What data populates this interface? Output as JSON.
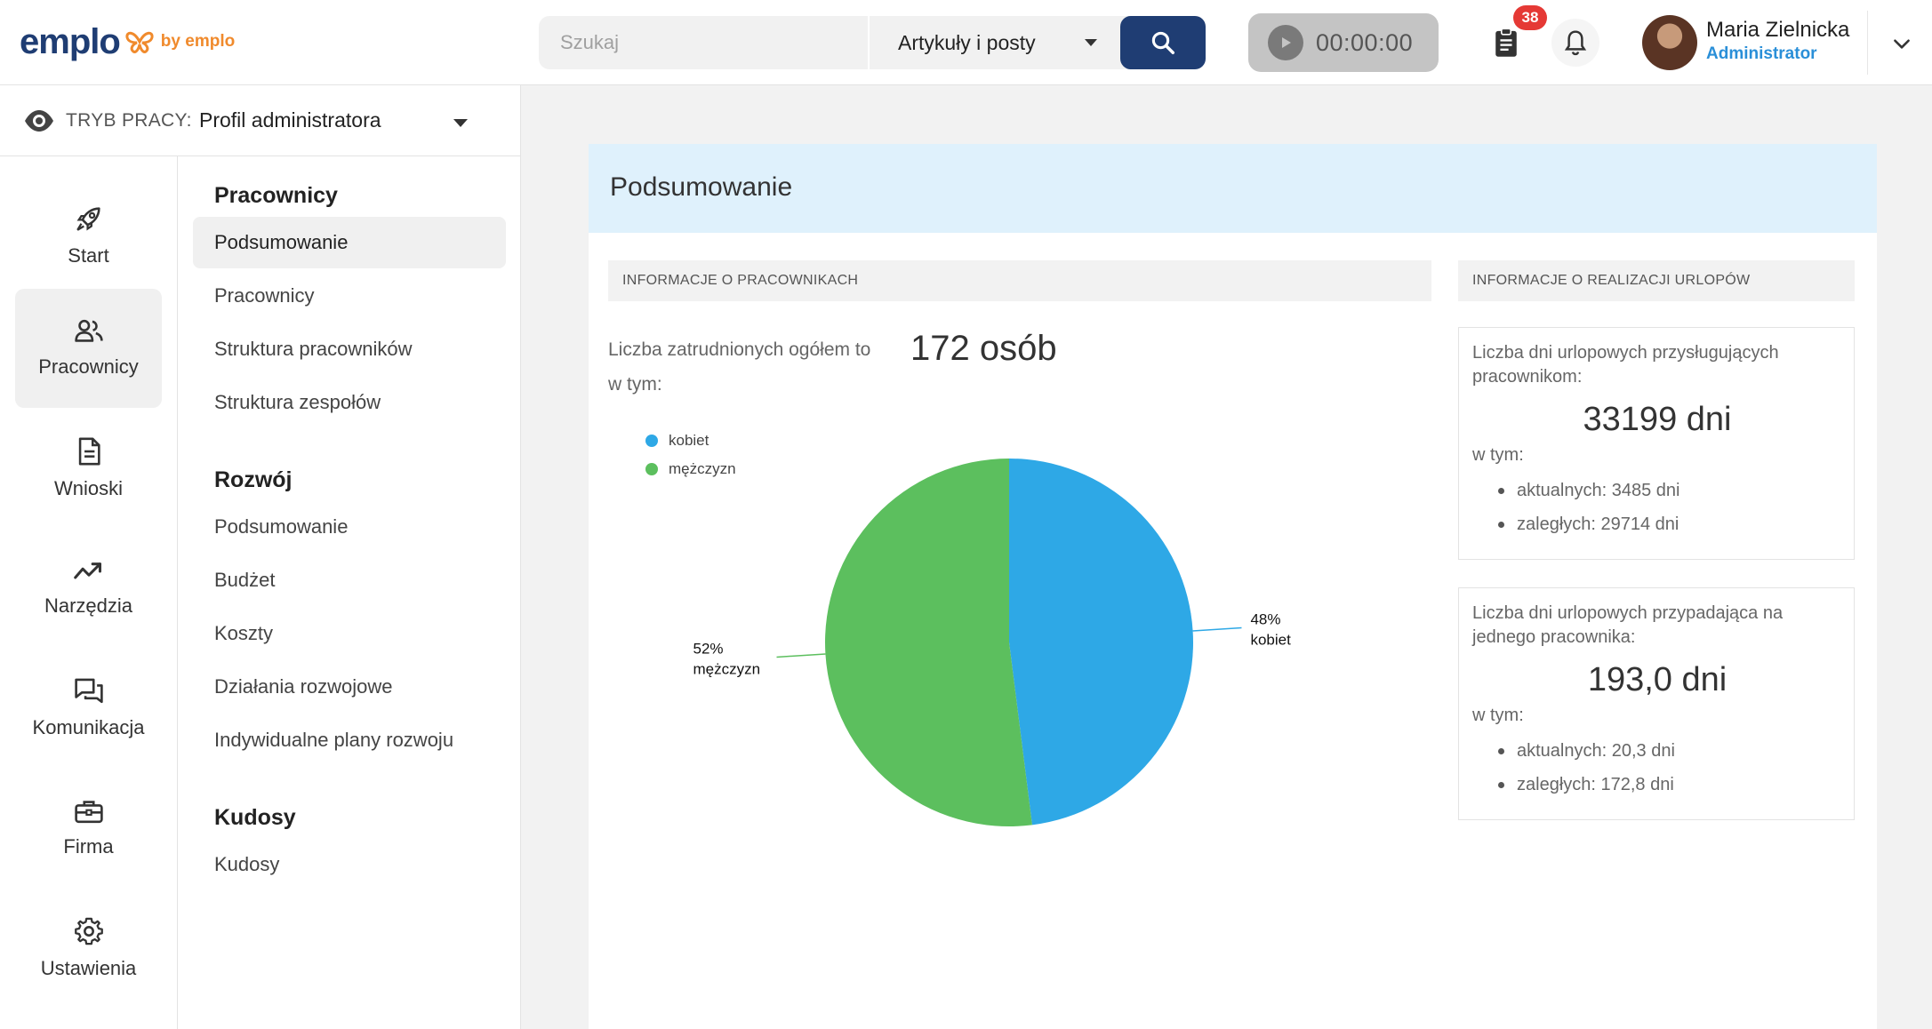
{
  "header": {
    "logo_text": "emplo",
    "logo_by": "by emplo",
    "search_placeholder": "Szukaj",
    "search_scope": "Artykuły i posty",
    "timer": "00:00:00",
    "tasks_badge": "38",
    "user_name": "Maria Zielnicka",
    "user_role": "Administrator"
  },
  "mode": {
    "label": "TRYB PRACY:",
    "value": "Profil administratora"
  },
  "nav": [
    {
      "label": "Start",
      "icon": "rocket-icon"
    },
    {
      "label": "Pracownicy",
      "icon": "people-icon"
    },
    {
      "label": "Wnioski",
      "icon": "document-icon"
    },
    {
      "label": "Narzędzia",
      "icon": "trend-icon"
    },
    {
      "label": "Komunikacja",
      "icon": "chat-icon"
    },
    {
      "label": "Firma",
      "icon": "briefcase-icon"
    },
    {
      "label": "Ustawienia",
      "icon": "gear-icon"
    }
  ],
  "submenu": {
    "sections": [
      {
        "title": "Pracownicy",
        "items": [
          "Podsumowanie",
          "Pracownicy",
          "Struktura pracowników",
          "Struktura zespołów"
        ]
      },
      {
        "title": "Rozwój",
        "items": [
          "Podsumowanie",
          "Budżet",
          "Koszty",
          "Działania rozwojowe",
          "Indywidualne plany rozwoju"
        ]
      },
      {
        "title": "Kudosy",
        "items": [
          "Kudosy"
        ]
      }
    ]
  },
  "main": {
    "title": "Podsumowanie",
    "employees": {
      "section_title": "INFORMACJE O PRACOWNIKACH",
      "total_text": "Liczba zatrudnionych ogółem to",
      "in_that": "w tym:",
      "total_value": "172 osób"
    },
    "leave": {
      "section_title": "INFORMACJE O REALIZACJI URLOPÓW",
      "box1": {
        "label": "Liczba dni urlopowych przysługujących pracownikom:",
        "value": "33199 dni",
        "in_that": "w tym:",
        "current": "aktualnych: 3485 dni",
        "overdue": "zaległych: 29714 dni"
      },
      "box2": {
        "label": "Liczba dni urlopowych przypadająca na jednego pracownika:",
        "value": "193,0 dni",
        "in_that": "w tym:",
        "current": "aktualnych: 20,3 dni",
        "overdue": "zaległych: 172,8 dni"
      }
    }
  },
  "chart_data": {
    "type": "pie",
    "categories": [
      "kobiet",
      "mężczyzn"
    ],
    "values": [
      48,
      52
    ],
    "unit": "%",
    "colors": [
      "#2ea8e6",
      "#5cbf5e"
    ],
    "data_labels": [
      "48%",
      "52%"
    ],
    "legend": "top-left"
  }
}
